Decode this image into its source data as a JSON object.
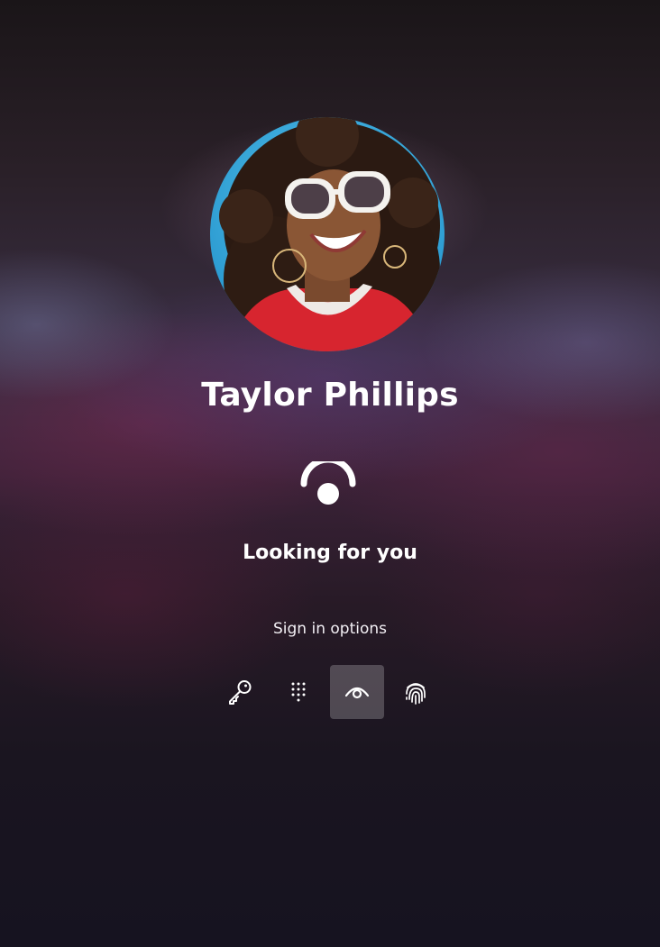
{
  "user": {
    "name": "Taylor Phillips",
    "avatar": "user-photo"
  },
  "auth": {
    "status": "Looking for you",
    "status_icon": "face-recognition-icon"
  },
  "sign_in_options": {
    "label": "Sign in options",
    "selected": "face",
    "options": [
      {
        "id": "password",
        "icon": "key-icon"
      },
      {
        "id": "pin",
        "icon": "keypad-icon"
      },
      {
        "id": "face",
        "icon": "eye-icon"
      },
      {
        "id": "fingerprint",
        "icon": "fingerprint-icon"
      }
    ]
  },
  "colors": {
    "text": "#ffffff",
    "selected_option_bg": "rgba(255,255,255,0.22)"
  }
}
